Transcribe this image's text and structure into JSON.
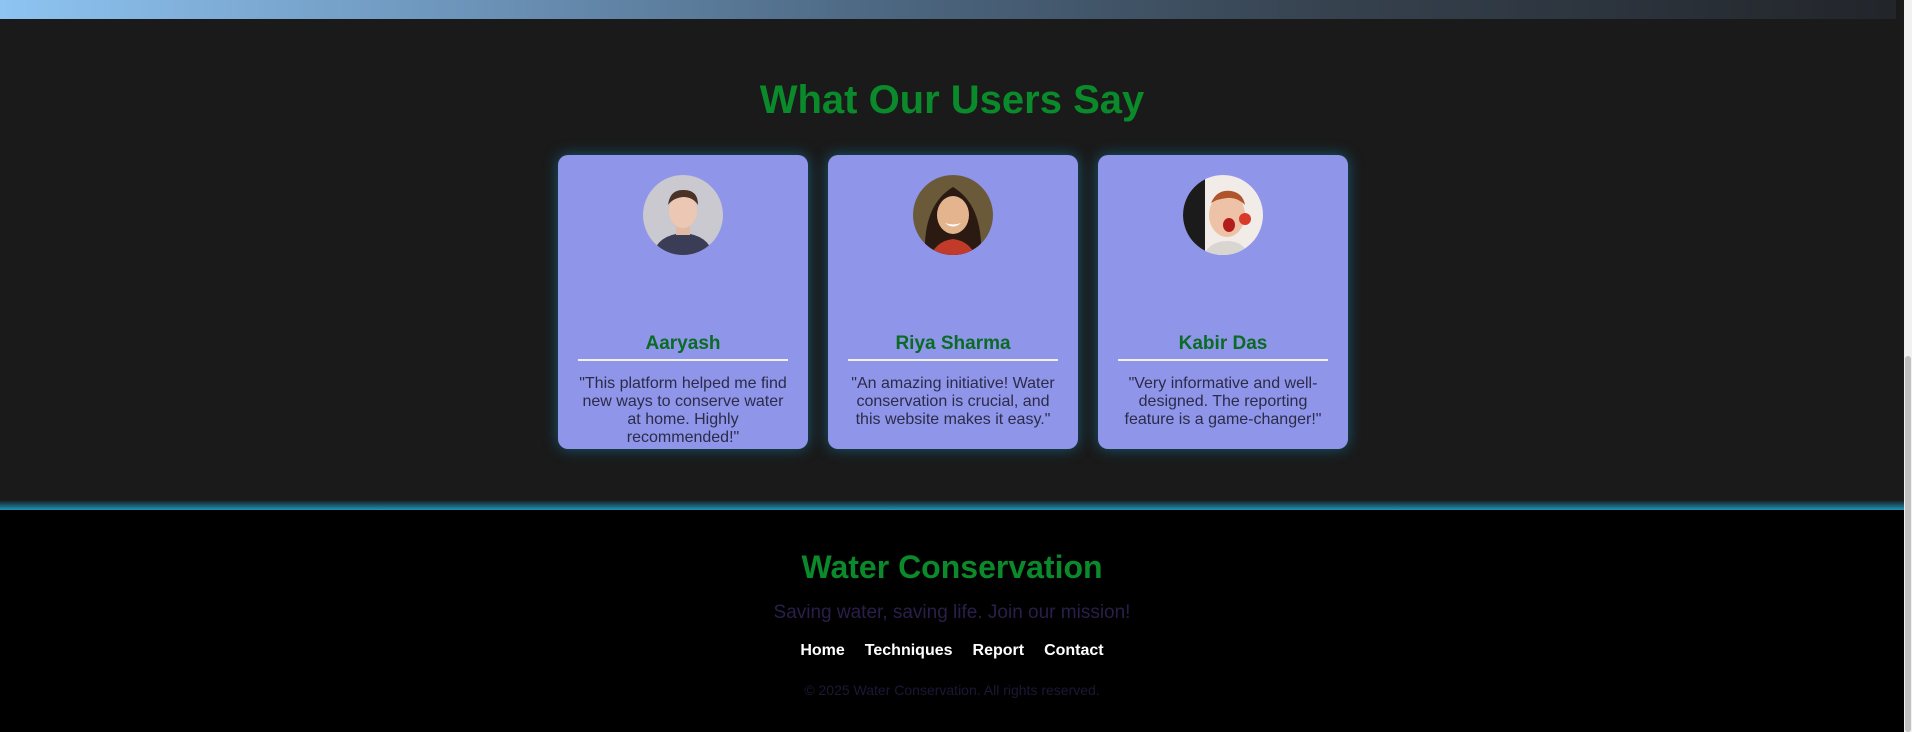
{
  "testimonials": {
    "title": "What Our Users Say",
    "cards": [
      {
        "name": "Aaryash",
        "quote": "\"This platform helped me find new ways to conserve water at home. Highly recommended!\"",
        "avatar": "avatar-photo-man"
      },
      {
        "name": "Riya Sharma",
        "quote": "\"An amazing initiative! Water conservation is crucial, and this website makes it easy.\"",
        "avatar": "avatar-photo-woman"
      },
      {
        "name": "Kabir Das",
        "quote": "\"Very informative and well-designed. The reporting feature is a game-changer!\"",
        "avatar": "avatar-photo-man-excited"
      }
    ]
  },
  "footer": {
    "title": "Water Conservation",
    "tagline": "Saving water, saving life. Join our mission!",
    "nav": [
      "Home",
      "Techniques",
      "Report",
      "Contact"
    ],
    "copyright": "© 2025 Water Conservation. All rights reserved."
  },
  "colors": {
    "accent_green": "#0a8a2a",
    "card_bg": "#8f95e8",
    "page_bg": "#1a1a1a",
    "footer_bg": "#000000",
    "glow": "#1ea0c8"
  }
}
